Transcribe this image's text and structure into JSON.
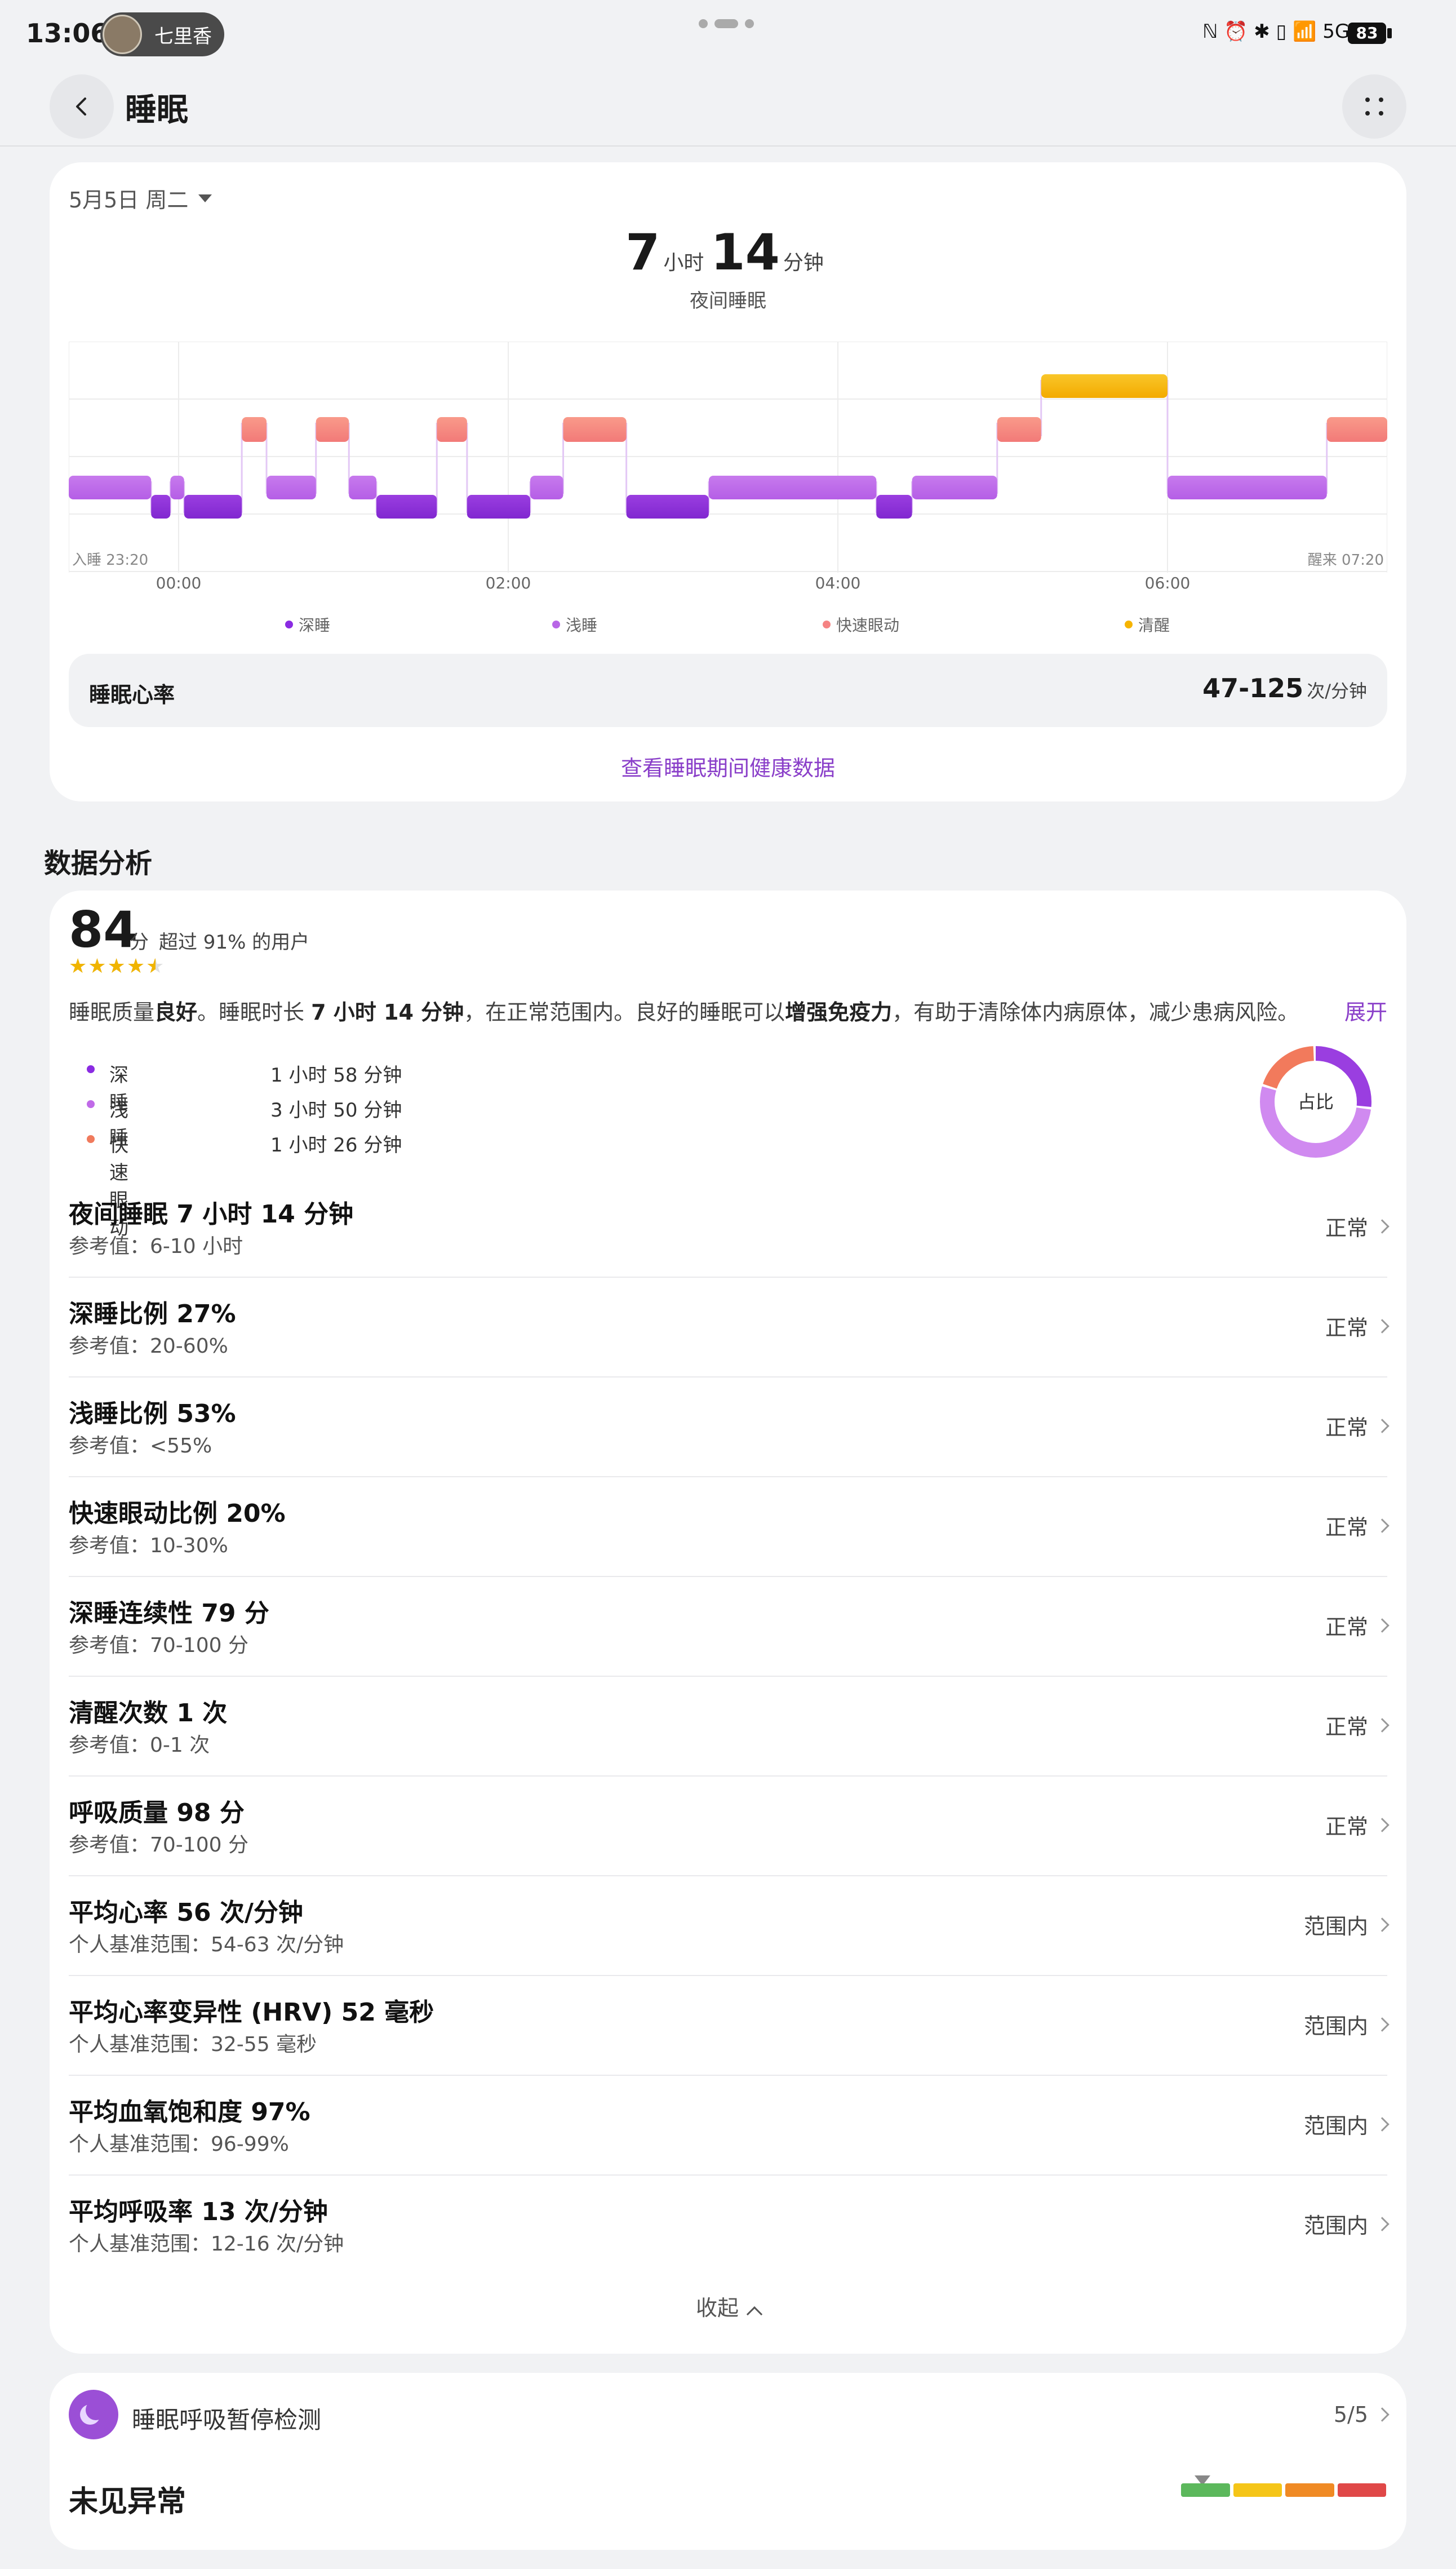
{
  "status_bar": {
    "time": "13:06",
    "user_name": "七里香",
    "icons": "ℕ ⏰ ✱ ▯ 📶 5G 5G",
    "battery": "83"
  },
  "header": {
    "title": "睡眠"
  },
  "sleep_card": {
    "date": "5月5日 周二",
    "hours": "7",
    "hours_unit": "小时",
    "minutes": "14",
    "minutes_unit": "分钟",
    "subtitle": "夜间睡眠",
    "sleep_start": "入睡 23:20",
    "wake_up": "醒来 07:20",
    "heart_rate_label": "睡眠心率",
    "heart_rate_value": "47-125",
    "heart_rate_unit": "次/分钟",
    "link": "查看睡眠期间健康数据"
  },
  "chart_data": {
    "type": "timeline",
    "x_ticks": [
      "00:00",
      "02:00",
      "04:00",
      "06:00"
    ],
    "x_start": "23:20",
    "x_end": "07:20",
    "legend": [
      {
        "name": "深睡",
        "color": "#8a2be2"
      },
      {
        "name": "浅睡",
        "color": "#b866e6"
      },
      {
        "name": "快速眼动",
        "color": "#f58383"
      },
      {
        "name": "清醒",
        "color": "#f6b400"
      }
    ],
    "segments": [
      {
        "stage": "浅睡",
        "start": "23:20",
        "end": "23:50"
      },
      {
        "stage": "深睡",
        "start": "23:50",
        "end": "23:57"
      },
      {
        "stage": "浅睡",
        "start": "23:57",
        "end": "00:02"
      },
      {
        "stage": "深睡",
        "start": "00:02",
        "end": "00:23"
      },
      {
        "stage": "快速眼动",
        "start": "00:23",
        "end": "00:32"
      },
      {
        "stage": "浅睡",
        "start": "00:32",
        "end": "00:50"
      },
      {
        "stage": "快速眼动",
        "start": "00:50",
        "end": "01:02"
      },
      {
        "stage": "浅睡",
        "start": "01:02",
        "end": "01:12"
      },
      {
        "stage": "深睡",
        "start": "01:12",
        "end": "01:34"
      },
      {
        "stage": "快速眼动",
        "start": "01:34",
        "end": "01:45"
      },
      {
        "stage": "深睡",
        "start": "01:45",
        "end": "02:08"
      },
      {
        "stage": "浅睡",
        "start": "02:08",
        "end": "02:20"
      },
      {
        "stage": "快速眼动",
        "start": "02:20",
        "end": "02:43"
      },
      {
        "stage": "深睡",
        "start": "02:43",
        "end": "03:13"
      },
      {
        "stage": "浅睡",
        "start": "03:13",
        "end": "04:14"
      },
      {
        "stage": "深睡",
        "start": "04:14",
        "end": "04:27"
      },
      {
        "stage": "浅睡",
        "start": "04:27",
        "end": "04:58"
      },
      {
        "stage": "快速眼动",
        "start": "04:58",
        "end": "05:14"
      },
      {
        "stage": "清醒",
        "start": "05:14",
        "end": "06:00"
      },
      {
        "stage": "浅睡",
        "start": "06:00",
        "end": "06:58"
      },
      {
        "stage": "快速眼动",
        "start": "06:58",
        "end": "07:20"
      }
    ]
  },
  "analysis": {
    "section_title": "数据分析",
    "score": "84",
    "score_unit": "分",
    "beat": "超过 91% 的用户",
    "stars": "★★★★★",
    "star_rating": 4.5,
    "summary_a": "睡眠质量",
    "summary_b": "良好",
    "summary_c": "。睡眠时长 ",
    "summary_d": "7 小时 14 分钟",
    "summary_e": "，在正常范围内。良好的睡眠可以",
    "summary_f": "增强免疫力",
    "summary_g": "，有助于清除体内病原体，减少患病风险。",
    "expand": "展开",
    "stages": [
      {
        "name": "深睡",
        "value": "1 小时 58 分钟",
        "color": "#8a2be2"
      },
      {
        "name": "浅睡",
        "value": "3 小时 50 分钟",
        "color": "#c06ae8"
      },
      {
        "name": "快速眼动",
        "value": "1 小时 26 分钟",
        "color": "#f07a5c"
      }
    ],
    "donut_label": "占比",
    "metrics": [
      {
        "title": "夜间睡眠 7 小时 14 分钟",
        "ref": "参考值：6-10 小时",
        "status": "正常"
      },
      {
        "title": "深睡比例 27%",
        "ref": "参考值：20-60%",
        "status": "正常"
      },
      {
        "title": "浅睡比例 53%",
        "ref": "参考值：<55%",
        "status": "正常"
      },
      {
        "title": "快速眼动比例 20%",
        "ref": "参考值：10-30%",
        "status": "正常"
      },
      {
        "title": "深睡连续性 79 分",
        "ref": "参考值：70-100 分",
        "status": "正常"
      },
      {
        "title": "清醒次数 1 次",
        "ref": "参考值：0-1 次",
        "status": "正常"
      },
      {
        "title": "呼吸质量 98 分",
        "ref": "参考值：70-100 分",
        "status": "正常"
      },
      {
        "title": "平均心率 56 次/分钟",
        "ref": "个人基准范围：54-63 次/分钟",
        "status": "范围内"
      },
      {
        "title": "平均心率变异性 (HRV) 52 毫秒",
        "ref": "个人基准范围：32-55 毫秒",
        "status": "范围内"
      },
      {
        "title": "平均血氧饱和度 97%",
        "ref": "个人基准范围：96-99%",
        "status": "范围内"
      },
      {
        "title": "平均呼吸率 13 次/分钟",
        "ref": "个人基准范围：12-16 次/分钟",
        "status": "范围内"
      }
    ],
    "collapse": "收起"
  },
  "apnea": {
    "title": "睡眠呼吸暂停检测",
    "count": "5/5",
    "result": "未见异常",
    "scale_colors": [
      "#5cb85c",
      "#f5c518",
      "#f08a24",
      "#e04848"
    ]
  }
}
